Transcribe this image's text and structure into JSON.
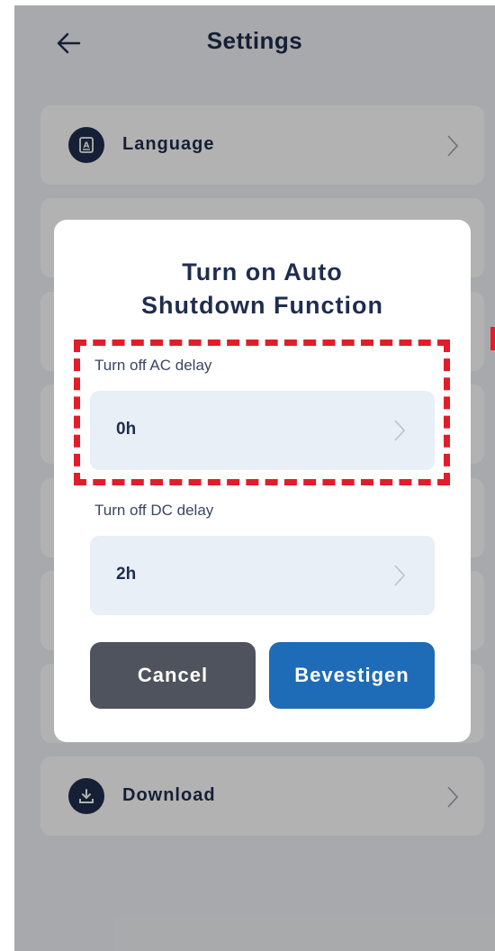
{
  "header": {
    "title": "Settings"
  },
  "settings_rows": [
    {
      "label": "Language",
      "icon": "language-icon"
    },
    {
      "label": "",
      "icon": ""
    },
    {
      "label": "",
      "icon": ""
    },
    {
      "label": "",
      "icon": ""
    },
    {
      "label": "",
      "icon": ""
    },
    {
      "label": "",
      "icon": ""
    },
    {
      "label": "",
      "icon": ""
    },
    {
      "label": "Download",
      "icon": "download-icon"
    }
  ],
  "dialog": {
    "title_line1": "Turn on Auto",
    "title_line2": "Shutdown Function",
    "ac_label": "Turn off AC delay",
    "ac_value": "0h",
    "dc_label": "Turn off DC delay",
    "dc_value": "2h",
    "cancel_label": "Cancel",
    "confirm_label": "Bevestigen"
  },
  "colors": {
    "primary_text": "#1f2d4d",
    "confirm_button": "#1e6bb8",
    "cancel_button": "#4f535d",
    "highlight": "#e11d2a",
    "field_bg": "#e8eff7"
  }
}
